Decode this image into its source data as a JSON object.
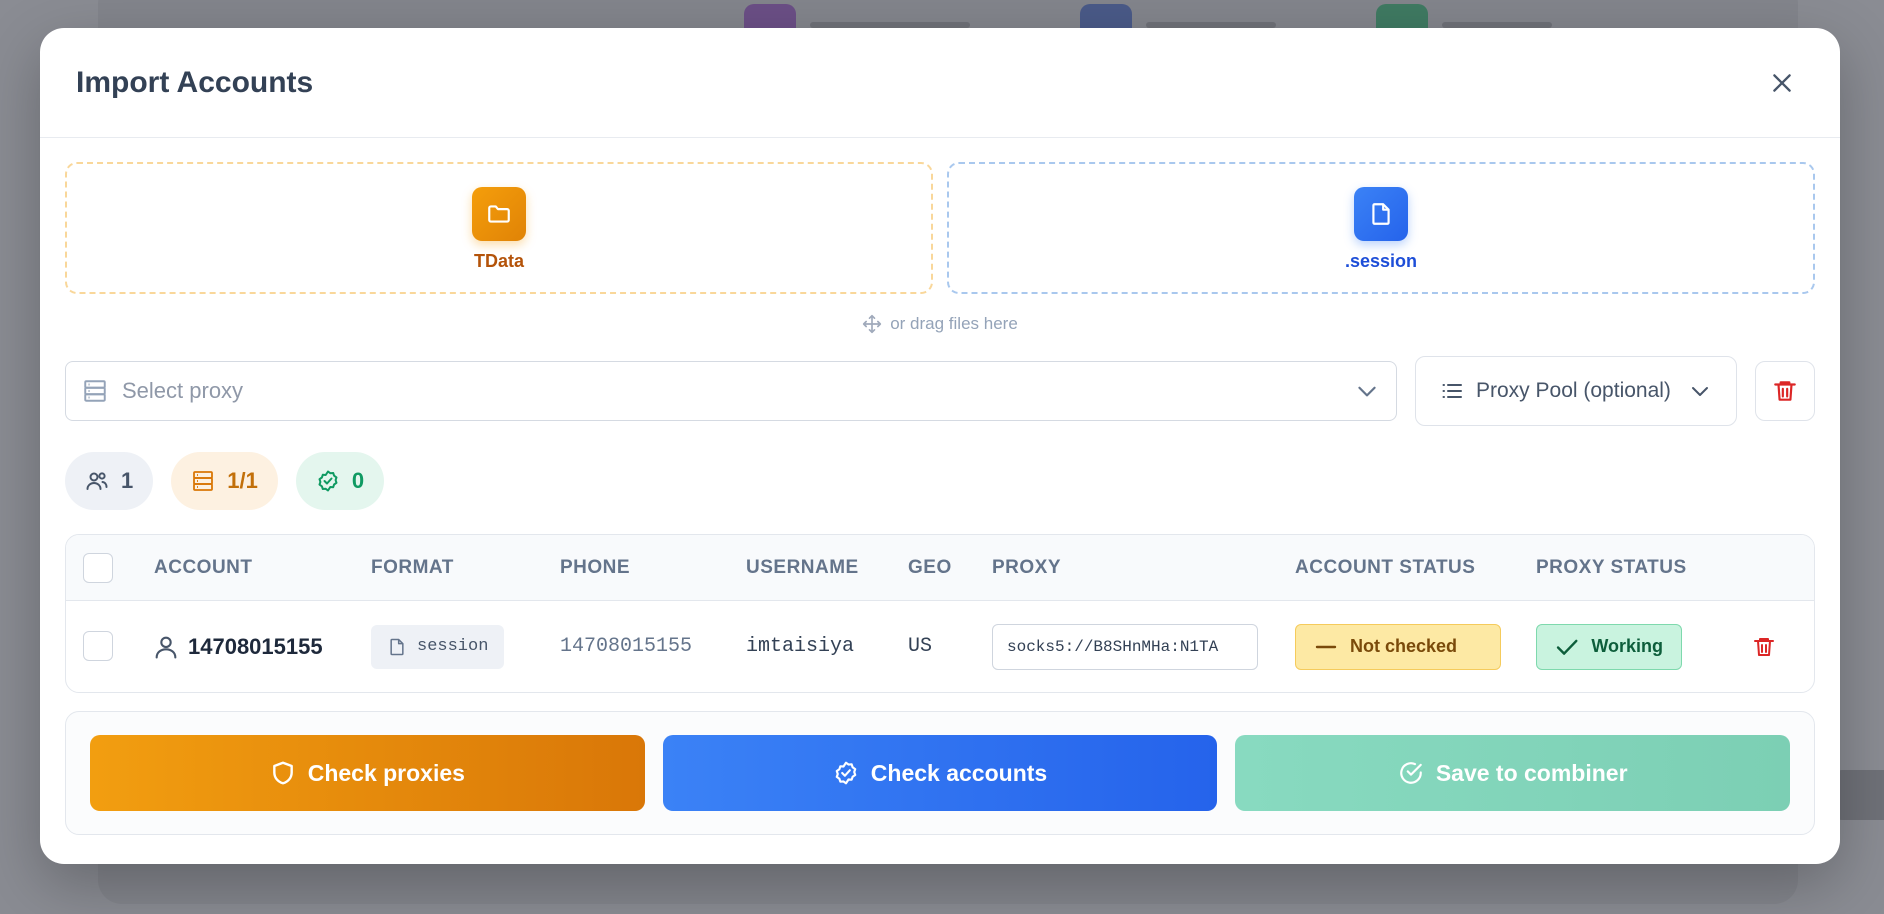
{
  "modal": {
    "title": "Import Accounts"
  },
  "drop_zones": {
    "tdata_label": "TData",
    "session_label": ".session",
    "drag_hint": "or drag files here"
  },
  "proxy": {
    "select_placeholder": "Select proxy",
    "pool_label": "Proxy Pool (optional)"
  },
  "stats": {
    "accounts": "1",
    "proxies": "1/1",
    "valid": "0"
  },
  "table": {
    "columns": [
      "ACCOUNT",
      "FORMAT",
      "PHONE",
      "USERNAME",
      "GEO",
      "PROXY",
      "ACCOUNT STATUS",
      "PROXY STATUS"
    ],
    "rows": [
      {
        "account": "14708015155",
        "format": "session",
        "phone": "14708015155",
        "username": "imtaisiya",
        "geo": "US",
        "proxy": "socks5://B8SHnMHa:N1TA",
        "account_status": "Not checked",
        "proxy_status": "Working"
      }
    ]
  },
  "actions": {
    "check_proxies": "Check proxies",
    "check_accounts": "Check accounts",
    "save_to_combiner": "Save to combiner"
  },
  "colors": {
    "orange": "#f59e0b",
    "blue": "#2563eb",
    "green": "#10b981",
    "danger": "#dc2626"
  }
}
